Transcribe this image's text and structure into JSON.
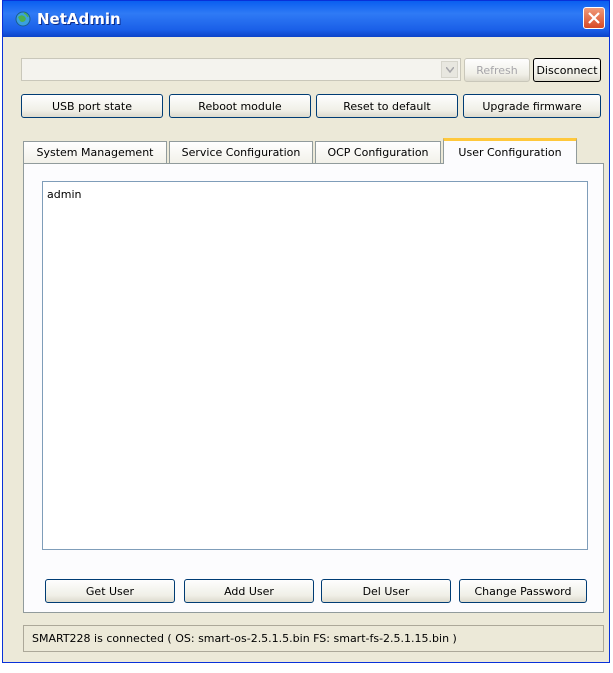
{
  "window": {
    "title": "NetAdmin"
  },
  "toolbar": {
    "device_combo_value": "",
    "refresh_label": "Refresh",
    "disconnect_label": "Disconnect"
  },
  "actions": {
    "usb_port_state_label": "USB port state",
    "reboot_module_label": "Reboot module",
    "reset_to_default_label": "Reset to default",
    "upgrade_firmware_label": "Upgrade firmware"
  },
  "tabs": [
    {
      "label": "System Management",
      "active": false
    },
    {
      "label": "Service Configuration",
      "active": false
    },
    {
      "label": "OCP Configuration",
      "active": false
    },
    {
      "label": "User Configuration",
      "active": true
    }
  ],
  "user_list": {
    "items": [
      "admin"
    ]
  },
  "user_buttons": {
    "get_user_label": "Get User",
    "add_user_label": "Add User",
    "del_user_label": "Del User",
    "change_password_label": "Change Password"
  },
  "status": {
    "text": "SMART228 is connected ( OS: smart-os-2.5.1.5.bin  FS: smart-fs-2.5.1.15.bin )"
  },
  "icons": {
    "app": "globe-icon",
    "close": "close-icon",
    "dropdown": "chevron-down-icon"
  },
  "colors": {
    "titlebar": "#0a5ff0",
    "close_button": "#d84a26",
    "active_tab_accent": "#ffc83c",
    "window_background": "#ece9d8"
  }
}
